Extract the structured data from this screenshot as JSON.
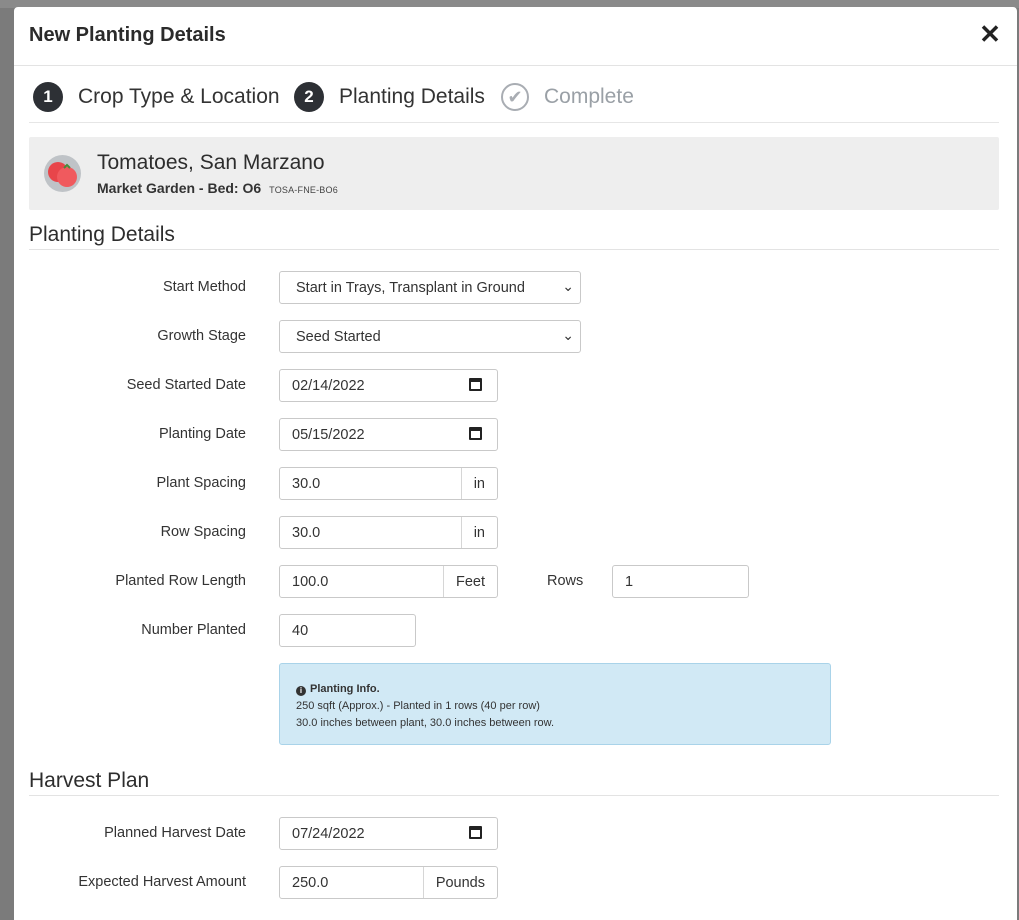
{
  "modal": {
    "title": "New Planting Details",
    "close": "✕"
  },
  "steps": [
    {
      "num": "1",
      "label": "Crop Type & Location"
    },
    {
      "num": "2",
      "label": "Planting Details"
    },
    {
      "num": "✔",
      "label": "Complete"
    }
  ],
  "crop": {
    "name": "Tomatoes, San Marzano",
    "location": "Market Garden - Bed: O6",
    "code": "TOSA-FNE-BO6"
  },
  "planting": {
    "section_title": "Planting Details",
    "start_method": {
      "label": "Start Method",
      "value": "Start in Trays, Transplant in Ground"
    },
    "growth_stage": {
      "label": "Growth Stage",
      "value": "Seed Started"
    },
    "seed_started_date": {
      "label": "Seed Started Date",
      "value": "02/14/2022"
    },
    "planting_date": {
      "label": "Planting Date",
      "value": "05/15/2022"
    },
    "plant_spacing": {
      "label": "Plant Spacing",
      "value": "30.0",
      "unit": "in"
    },
    "row_spacing": {
      "label": "Row Spacing",
      "value": "30.0",
      "unit": "in"
    },
    "planted_row_length": {
      "label": "Planted Row Length",
      "value": "100.0",
      "unit": "Feet"
    },
    "rows": {
      "label": "Rows",
      "value": "1"
    },
    "number_planted": {
      "label": "Number Planted",
      "value": "40"
    },
    "info": {
      "icon": "i",
      "title": "Planting Info.",
      "line1": "250 sqft (Approx.) - Planted in 1 rows (40 per row)",
      "line2": "30.0 inches between plant, 30.0 inches between row."
    }
  },
  "harvest": {
    "section_title": "Harvest Plan",
    "planned_harvest_date": {
      "label": "Planned Harvest Date",
      "value": "07/24/2022"
    },
    "expected_harvest_amount": {
      "label": "Expected Harvest Amount",
      "value": "250.0",
      "unit": "Pounds"
    }
  }
}
